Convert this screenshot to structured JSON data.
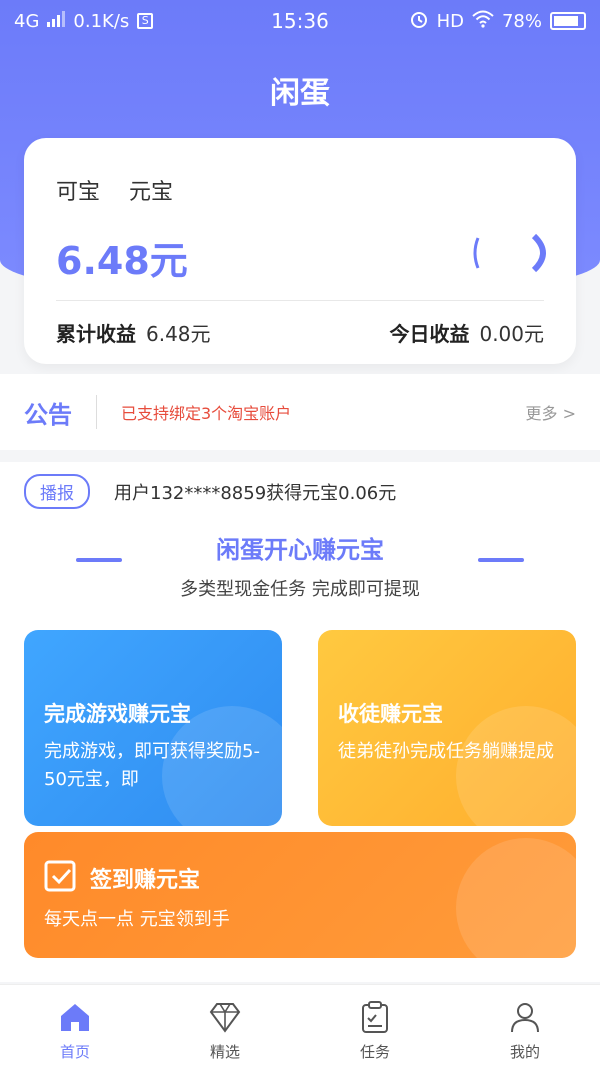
{
  "status_bar": {
    "network": "4G",
    "speed": "0.1K/s",
    "sim_badge": "S",
    "time": "15:36",
    "hd": "HD",
    "battery": "78%"
  },
  "app": {
    "title": "闲蛋",
    "accent_color": "#6c7bf9"
  },
  "balance": {
    "label_primary": "可宝",
    "label_secondary": "元宝",
    "amount": "6.48元",
    "total_label": "累计收益",
    "total_value": "6.48元",
    "today_label": "今日收益",
    "today_value": "0.00元"
  },
  "notice": {
    "title": "公告",
    "text": "已支持绑定3个淘宝账户",
    "more": "更多 >"
  },
  "broadcast": {
    "tag": "播报",
    "text": "用户132****8859获得元宝0.06元"
  },
  "section": {
    "title": "闲蛋开心赚元宝",
    "subtitle": "多类型现金任务 完成即可提现"
  },
  "tasks": {
    "game": {
      "title": "完成游戏赚元宝",
      "desc": "完成游戏，即可获得奖励5-50元宝，即",
      "color": "#40a6ff"
    },
    "invite": {
      "title": "收徒赚元宝",
      "desc": "徒弟徒孙完成任务躺赚提成",
      "color": "#ffb830"
    },
    "signin": {
      "title": "签到赚元宝",
      "desc": "每天点一点 元宝领到手",
      "color": "#ff8a2a"
    }
  },
  "tabbar": {
    "items": [
      {
        "label": "首页",
        "icon": "home-icon"
      },
      {
        "label": "精选",
        "icon": "diamond-icon"
      },
      {
        "label": "任务",
        "icon": "clipboard-icon"
      },
      {
        "label": "我的",
        "icon": "user-icon"
      }
    ]
  }
}
